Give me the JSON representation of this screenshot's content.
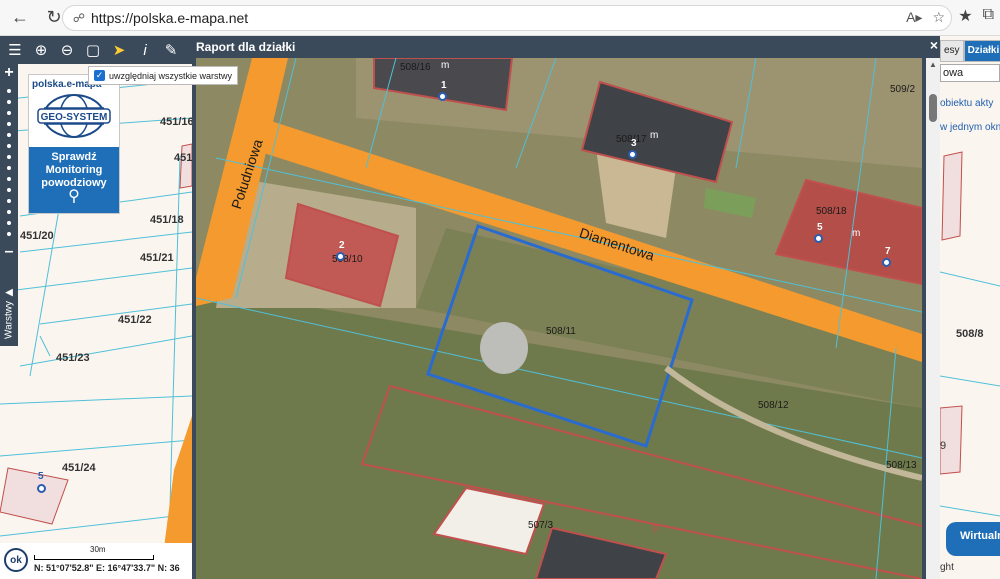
{
  "browser": {
    "url": "https://polska.e-mapa.net"
  },
  "toolbar": {
    "layers_checkbox_label": "uwzględniaj wszystkie warstwy"
  },
  "logo": {
    "top_text": "polska.e-mapa",
    "brand": "GEO-SYSTEM",
    "promo_line1": "Sprawdź",
    "promo_line2": "Monitoring",
    "promo_line3": "powodziowy"
  },
  "sidebar": {
    "layers_tab": "Warstwy"
  },
  "left_map": {
    "parcels": [
      "451/16",
      "451/18",
      "451/20",
      "451/21",
      "451/22",
      "451/23",
      "451/24",
      "451"
    ],
    "marker_number": "5"
  },
  "scale": {
    "ok_label": "ok",
    "scale_text": "30m",
    "coordinates": "N: 51°07'52.8\" E: 16°47'33.7\" N: 36"
  },
  "dialog": {
    "title": "Raport dla działki",
    "close": "×",
    "streets": [
      "Południowa",
      "Diamentowa"
    ],
    "parcels": [
      "508/16",
      "508/17",
      "508/18",
      "509/2",
      "508/10",
      "508/11",
      "508/12",
      "508/13",
      "507/3"
    ],
    "markers": [
      "1",
      "3",
      "2",
      "5",
      "7"
    ],
    "labels_m": "m",
    "label_9": "9"
  },
  "right_panel": {
    "tab1": "esy",
    "tab2": "Działki",
    "input_value": "owa",
    "text1": "obiektu akty",
    "text2": "w jednym oknie",
    "parcel_label": "508/8",
    "edge_label": "9",
    "bottom_text": "ght",
    "virtual_button": "Wirtualn"
  }
}
